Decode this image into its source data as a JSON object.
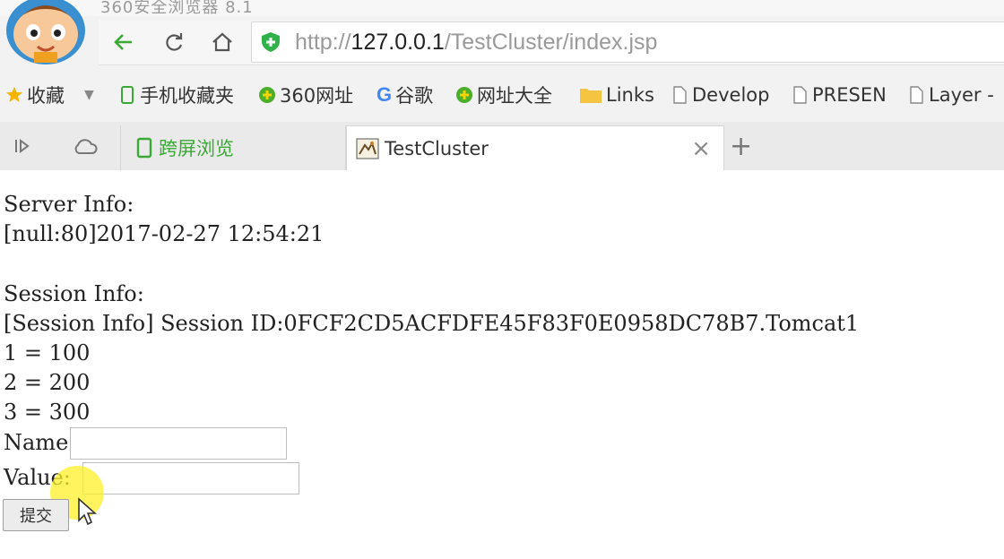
{
  "browser": {
    "title_strip_text": "360安全浏览器 8.1",
    "address": {
      "scheme": "http://",
      "host": "127.0.0.1",
      "path": "/TestCluster/index.jsp"
    },
    "bookmarks": [
      {
        "label": "收藏",
        "icon": "star-icon"
      },
      {
        "label": "手机收藏夹",
        "icon": "phone-icon"
      },
      {
        "label": "360网址",
        "icon": "plus-circle-icon"
      },
      {
        "label": "谷歌",
        "icon": "google-icon"
      },
      {
        "label": "网址大全",
        "icon": "plus-circle-icon"
      },
      {
        "label": "Links",
        "icon": "folder-icon"
      },
      {
        "label": "Develop",
        "icon": "page-icon"
      },
      {
        "label": "PRESEN",
        "icon": "page-icon"
      },
      {
        "label": "Layer -",
        "icon": "page-icon"
      }
    ],
    "tabs": [
      {
        "label": "跨屏浏览",
        "active": false
      },
      {
        "label": "TestCluster",
        "active": true
      }
    ],
    "colors": {
      "accent_green": "#3aa935",
      "shield_green": "#2fb24a",
      "chrome_bg": "#f2f2f2",
      "cursor_highlight": "#fff028"
    }
  },
  "page": {
    "server_heading": "Server Info:",
    "server_value": "[null:80]2017-02-27 12:54:21",
    "session_heading": "Session Info:",
    "session_value": "[Session Info] Session ID:0FCF2CD5ACFDFE45F83F0E0958DC78B7.Tomcat1",
    "attributes": [
      "1 = 100",
      "2 = 200",
      "3 = 300"
    ],
    "form": {
      "name_label": "Name:",
      "name_value": "",
      "value_label": "Value:",
      "value_value": "",
      "submit_label": "提交"
    }
  }
}
